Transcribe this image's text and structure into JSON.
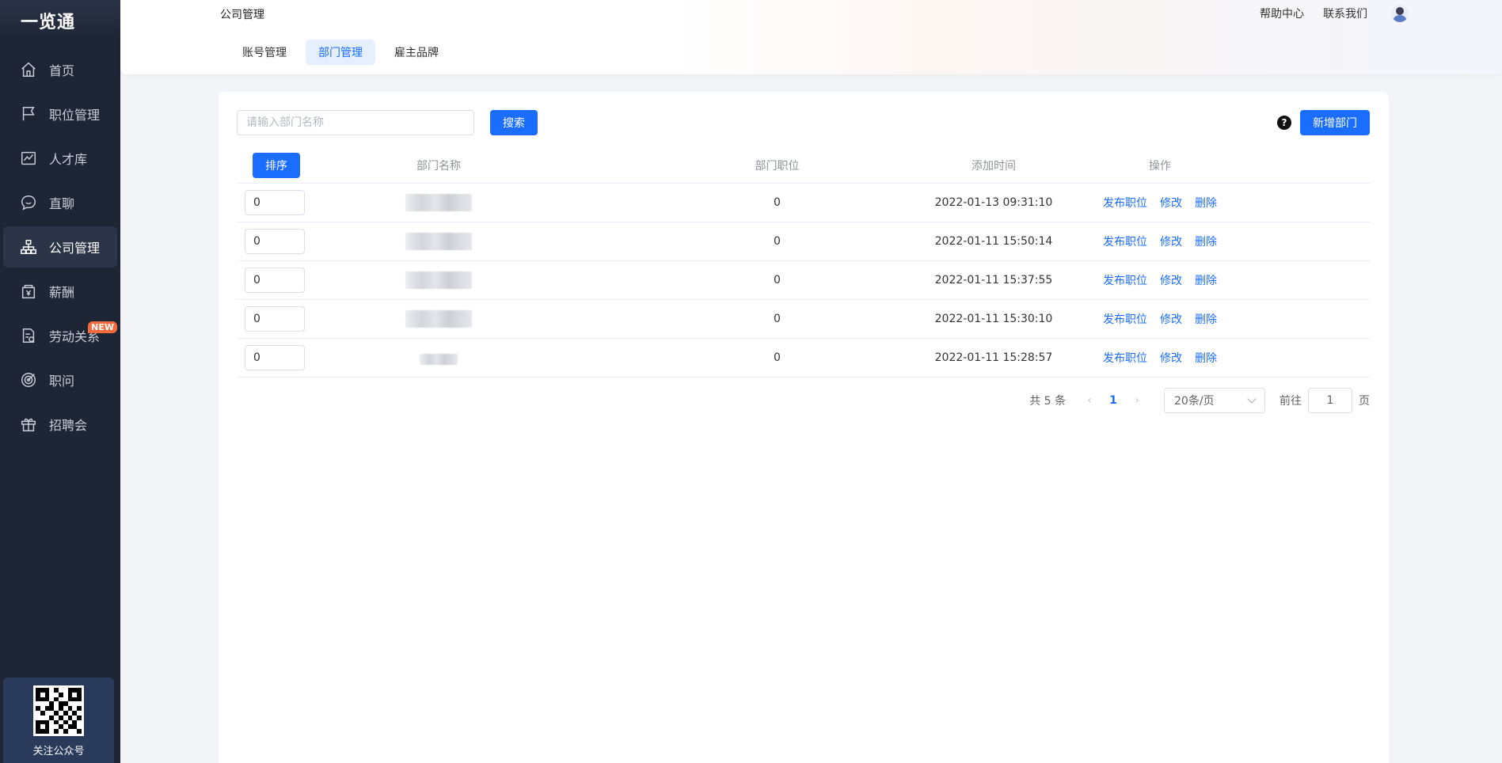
{
  "app": {
    "logo": "一览通"
  },
  "sidebar": {
    "items": [
      {
        "label": "首页",
        "icon": "home-icon"
      },
      {
        "label": "职位管理",
        "icon": "flag-icon"
      },
      {
        "label": "人才库",
        "icon": "chart-line-icon"
      },
      {
        "label": "直聊",
        "icon": "chat-icon"
      },
      {
        "label": "公司管理",
        "icon": "org-chart-icon",
        "active": true
      },
      {
        "label": "薪酬",
        "icon": "wallet-icon"
      },
      {
        "label": "劳动关系",
        "icon": "contract-icon",
        "badge": "NEW"
      },
      {
        "label": "职问",
        "icon": "target-icon"
      },
      {
        "label": "招聘会",
        "icon": "gift-icon"
      }
    ],
    "qr_label": "关注公众号"
  },
  "header": {
    "title": "公司管理",
    "help": "帮助中心",
    "contact": "联系我们",
    "tabs": [
      {
        "label": "账号管理"
      },
      {
        "label": "部门管理",
        "active": true
      },
      {
        "label": "雇主品牌"
      }
    ]
  },
  "toolbar": {
    "search_placeholder": "请输入部门名称",
    "search_label": "搜索",
    "help_symbol": "?",
    "add_label": "新增部门"
  },
  "table": {
    "sort_label": "排序",
    "headers": {
      "name": "部门名称",
      "count": "部门职位",
      "time": "添加时间",
      "ops": "操作"
    },
    "ops": {
      "publish": "发布职位",
      "edit": "修改",
      "delete": "删除"
    },
    "rows": [
      {
        "sort": "0",
        "count": "0",
        "time": "2022-01-13 09:31:10"
      },
      {
        "sort": "0",
        "count": "0",
        "time": "2022-01-11 15:50:14"
      },
      {
        "sort": "0",
        "count": "0",
        "time": "2022-01-11 15:37:55"
      },
      {
        "sort": "0",
        "count": "0",
        "time": "2022-01-11 15:30:10"
      },
      {
        "sort": "0",
        "count": "0",
        "time": "2022-01-11 15:28:57"
      }
    ]
  },
  "pagination": {
    "total": "共 5 条",
    "current": "1",
    "page_size": "20条/页",
    "goto_label": "前往",
    "goto_value": "1",
    "goto_suffix": "页"
  },
  "colors": {
    "primary": "#1a6dff",
    "sidebar_bg": "#1e2535",
    "badge": "#f56a3c"
  }
}
